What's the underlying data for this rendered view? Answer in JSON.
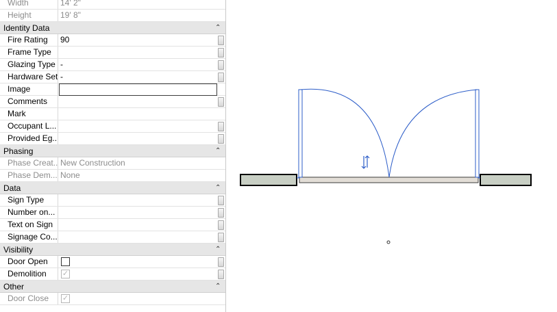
{
  "groups": {
    "identity": "Identity Data",
    "phasing": "Phasing",
    "data": "Data",
    "visibility": "Visibility",
    "other": "Other"
  },
  "rows": {
    "width": {
      "label": "Width",
      "value": "14'  2\""
    },
    "height": {
      "label": "Height",
      "value": "19'  8\""
    },
    "fire_rating": {
      "label": "Fire Rating",
      "value": "90"
    },
    "frame_type": {
      "label": "Frame Type",
      "value": ""
    },
    "glazing_type": {
      "label": "Glazing Type",
      "value": "-"
    },
    "hardware_set": {
      "label": "Hardware Set",
      "value": "-"
    },
    "image": {
      "label": "Image",
      "value": ""
    },
    "comments": {
      "label": "Comments",
      "value": ""
    },
    "mark": {
      "label": "Mark",
      "value": ""
    },
    "occupant_load": {
      "label": "Occupant L...",
      "value": ""
    },
    "provided_egress": {
      "label": "Provided Eg...",
      "value": ""
    },
    "phase_created": {
      "label": "Phase Creat...",
      "value": "New Construction"
    },
    "phase_demolished": {
      "label": "Phase Dem...",
      "value": "None"
    },
    "sign_type": {
      "label": "Sign Type",
      "value": ""
    },
    "number_on": {
      "label": "Number on...",
      "value": ""
    },
    "text_on_sign": {
      "label": "Text on Sign",
      "value": ""
    },
    "signage_co": {
      "label": "Signage Co...",
      "value": ""
    },
    "door_open": {
      "label": "Door Open",
      "checked": false
    },
    "demolition": {
      "label": "Demolition",
      "checked": true
    },
    "door_close": {
      "label": "Door Close",
      "checked": true
    }
  },
  "icons": {
    "collapse": "chevron-up-double-icon",
    "flip": "flip-arrows-icon",
    "check": "check-icon"
  },
  "colors": {
    "door_swing": "#2b5cc8",
    "wall_fill": "#c8cfc4",
    "threshold_fill": "#e2ddd6"
  }
}
